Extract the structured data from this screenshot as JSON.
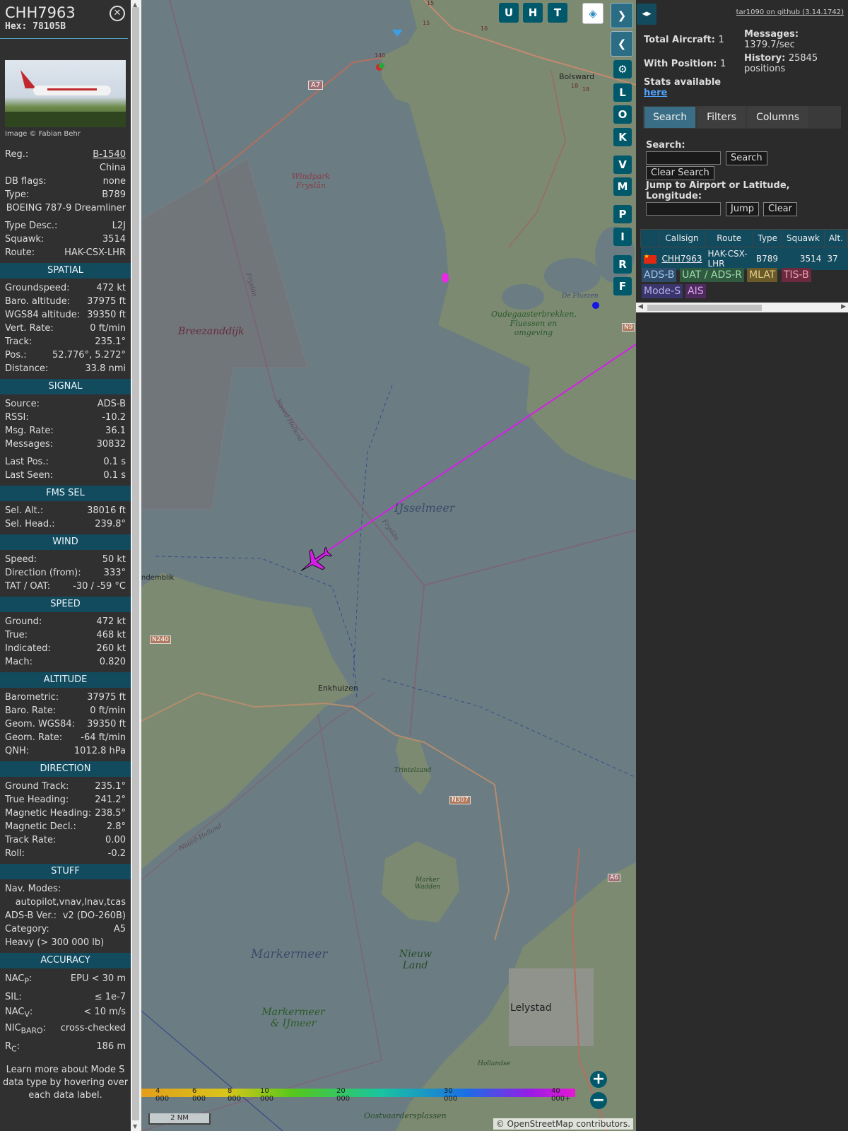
{
  "aircraft": {
    "callsign": "CHH7963",
    "hex_label": "Hex: 78105B",
    "image_credit": "Image © Fabian Behr",
    "reg_label": "Reg.:",
    "reg": "B-1540",
    "country": "China",
    "dbflags_label": "DB flags:",
    "dbflags": "none",
    "type_label": "Type:",
    "type": "B789",
    "type_full": "BOEING 787-9 Dreamliner",
    "typedesc_label": "Type Desc.:",
    "typedesc": "L2J",
    "squawk_label": "Squawk:",
    "squawk": "3514",
    "route_label": "Route:",
    "route": "HAK-CSX-LHR"
  },
  "sections": {
    "spatial": {
      "title": "SPATIAL",
      "rows": [
        {
          "k": "Groundspeed:",
          "v": "472 kt"
        },
        {
          "k": "Baro. altitude:",
          "v": "37975 ft"
        },
        {
          "k": "WGS84 altitude:",
          "v": "39350 ft"
        },
        {
          "k": "Vert. Rate:",
          "v": "0 ft/min"
        },
        {
          "k": "Track:",
          "v": "235.1°"
        },
        {
          "k": "Pos.:",
          "v": "52.776°, 5.272°"
        },
        {
          "k": "Distance:",
          "v": "33.8 nmi"
        }
      ]
    },
    "signal": {
      "title": "SIGNAL",
      "rows": [
        {
          "k": "Source:",
          "v": "ADS-B"
        },
        {
          "k": "RSSI:",
          "v": "-10.2"
        },
        {
          "k": "Msg. Rate:",
          "v": "36.1"
        },
        {
          "k": "Messages:",
          "v": "30832"
        }
      ],
      "rows2": [
        {
          "k": "Last Pos.:",
          "v": "0.1 s"
        },
        {
          "k": "Last Seen:",
          "v": "0.1 s"
        }
      ]
    },
    "fms": {
      "title": "FMS SEL",
      "rows": [
        {
          "k": "Sel. Alt.:",
          "v": "38016 ft"
        },
        {
          "k": "Sel. Head.:",
          "v": "239.8°"
        }
      ]
    },
    "wind": {
      "title": "WIND",
      "rows": [
        {
          "k": "Speed:",
          "v": "50 kt"
        },
        {
          "k": "Direction (from):",
          "v": "333°"
        },
        {
          "k": "TAT / OAT:",
          "v": "-30 / -59 °C"
        }
      ]
    },
    "speed": {
      "title": "SPEED",
      "rows": [
        {
          "k": "Ground:",
          "v": "472 kt"
        },
        {
          "k": "True:",
          "v": "468 kt"
        },
        {
          "k": "Indicated:",
          "v": "260 kt"
        },
        {
          "k": "Mach:",
          "v": "0.820"
        }
      ]
    },
    "altitude": {
      "title": "ALTITUDE",
      "rows": [
        {
          "k": "Barometric:",
          "v": "37975 ft"
        },
        {
          "k": "Baro. Rate:",
          "v": "0 ft/min"
        },
        {
          "k": "Geom. WGS84:",
          "v": "39350 ft"
        },
        {
          "k": "Geom. Rate:",
          "v": "-64 ft/min"
        },
        {
          "k": "QNH:",
          "v": "1012.8 hPa"
        }
      ]
    },
    "direction": {
      "title": "DIRECTION",
      "rows": [
        {
          "k": "Ground Track:",
          "v": "235.1°"
        },
        {
          "k": "True Heading:",
          "v": "241.2°"
        },
        {
          "k": "Magnetic Heading:",
          "v": "238.5°"
        },
        {
          "k": "Magnetic Decl.:",
          "v": "2.8°"
        },
        {
          "k": "Track Rate:",
          "v": "0.00"
        },
        {
          "k": "Roll:",
          "v": "-0.2"
        }
      ]
    },
    "stuff": {
      "title": "STUFF",
      "navmodes_label": "Nav. Modes:",
      "navmodes": "autopilot,vnav,lnav,tcas",
      "adsb_label": "ADS-B Ver.:",
      "adsb": "v2 (DO-260B)",
      "cat_label": "Category:",
      "cat": "A5",
      "heavy": "Heavy (> 300 000 lb)"
    },
    "accuracy": {
      "title": "ACCURACY",
      "nacp_k": "NAC",
      "nacp_sub": "P",
      "nacp_v": "EPU < 30 m",
      "sil_k": "SIL:",
      "sil_v": "≤ 1e-7",
      "nacv_k": "NAC",
      "nacv_sub": "V",
      "nacv_v": "< 10 m/s",
      "nicbaro_k": "NIC",
      "nicbaro_sub": "BARO",
      "nicbaro_v": "cross-checked",
      "rc_k": "R",
      "rc_sub": "C",
      "rc_v": "186 m"
    },
    "footer": "Learn more about Mode S data type by hovering over each data label."
  },
  "map": {
    "labels": {
      "bolsward": "Bolsward",
      "windpark": "Windpark Fryslân",
      "breezanddijk": "Breezanddijk",
      "ijsselmeer": "IJsselmeer",
      "fryslan1": "Fryslân",
      "fryslan2": "Fryslân",
      "noordholland1": "Noord-Holland",
      "noordholland2": "Noord-Holland",
      "oudegaaster": "Oudegaasterbrekken, Fluessen en omgeving",
      "defluezen": "De Fluezen",
      "andemblik": "ndemblik",
      "enkhuizen": "Enkhuizen",
      "trintelzand": "Trintelzand",
      "markerwadden": "Marker Wadden",
      "markermeer": "Markermeer",
      "nieuwland": "Nieuw Land",
      "markermeerijmeer": "Markermeer & IJmeer",
      "lelystad": "Lelystad",
      "oostvaarders": "Oostvaardersplassen",
      "hollandse": "Hollandse",
      "a7": "A7",
      "n240": "N240",
      "n307": "N307",
      "a6": "A6",
      "n9": "N9",
      "r15a": "15",
      "r15b": "15",
      "r16": "16",
      "r18a": "18",
      "r18b": "18",
      "r140": "140"
    },
    "buttons": {
      "u": "U",
      "h": "H",
      "t": "T",
      "l": "L",
      "o": "O",
      "k": "K",
      "v": "V",
      "m": "M",
      "p": "P",
      "i": "I",
      "r": "R",
      "f": "F",
      "zoom_in": "+",
      "zoom_out": "−"
    },
    "altitude_ticks": [
      "4 000",
      "6 000",
      "8 000",
      "10 000",
      "20 000",
      "30 000",
      "40 000+"
    ],
    "scale": "2 NM",
    "credit": "© OpenStreetMap contributors."
  },
  "panel": {
    "github": "tar1090 on github (3.14.1742)",
    "total_label": "Total Aircraft:",
    "total": "1",
    "withpos_label": "With Position:",
    "withpos": "1",
    "messages_label": "Messages:",
    "messages": "1379.7/sec",
    "history_label": "History:",
    "history": "25845",
    "history_unit": "positions",
    "stats": "Stats available",
    "here": "here",
    "tabs": [
      "Search",
      "Filters",
      "Columns"
    ],
    "search_label": "Search:",
    "search_btn": "Search",
    "clear_search_btn": "Clear Search",
    "jump_label": "Jump to Airport or Latitude, Longitude:",
    "jump_btn": "Jump",
    "clear_btn": "Clear",
    "table": {
      "headers": [
        "Callsign",
        "Route",
        "Type",
        "Squawk",
        "Alt."
      ],
      "row": {
        "callsign": "CHH7963",
        "route": "HAK-CSX-LHR",
        "type": "B789",
        "squawk": "3514",
        "alt": "37"
      }
    },
    "sources": [
      "ADS-B",
      "UAT / ADS-R",
      "MLAT",
      "TIS-B",
      "Mode-S",
      "AIS"
    ],
    "source_colors": [
      "#2f4c6b",
      "#2f5a3f",
      "#6a5a2a",
      "#6b2a3d",
      "#3a356a",
      "#4f2a5e"
    ],
    "source_text_colors": [
      "#9fc9f0",
      "#9fdcae",
      "#e6cf87",
      "#f0a0b8",
      "#b9b0f0",
      "#dfa7f0"
    ]
  }
}
